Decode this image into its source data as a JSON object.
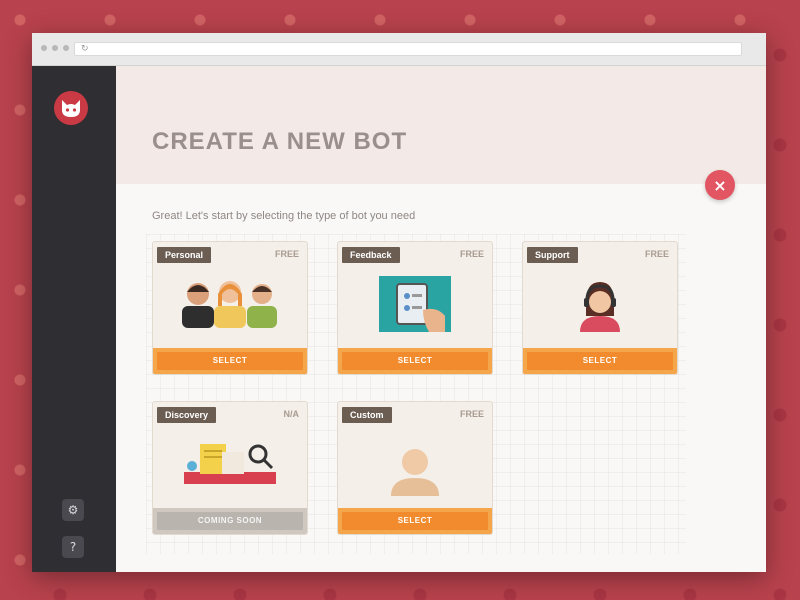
{
  "window": {
    "title": "CREATE A NEW BOT"
  },
  "header": {
    "title": "CREATE A NEW BOT",
    "subtitle": "Great! Let's start by selecting the type of bot you need"
  },
  "sidebar": {
    "logo": "cat-logo-icon",
    "buttons": [
      {
        "icon": "settings-icon"
      },
      {
        "icon": "help-icon"
      }
    ]
  },
  "close": {
    "label": "×"
  },
  "cards": [
    {
      "tag": "Personal",
      "price": "FREE",
      "button": "SELECT",
      "illustration": "three-people",
      "disabled": false
    },
    {
      "tag": "Feedback",
      "price": "FREE",
      "button": "SELECT",
      "illustration": "hand-tablet",
      "disabled": false
    },
    {
      "tag": "Support",
      "price": "FREE",
      "button": "SELECT",
      "illustration": "headset-agent",
      "disabled": false
    },
    {
      "tag": "Discovery",
      "price": "N/A",
      "button": "COMING SOON",
      "illustration": "search-documents",
      "disabled": true
    },
    {
      "tag": "Custom",
      "price": "FREE",
      "button": "SELECT",
      "illustration": "custom-person",
      "disabled": false
    }
  ],
  "colors": {
    "accent": "#f18b2d",
    "close": "#e25563",
    "sidebar": "#2f2e33",
    "background": "#b8424d"
  }
}
